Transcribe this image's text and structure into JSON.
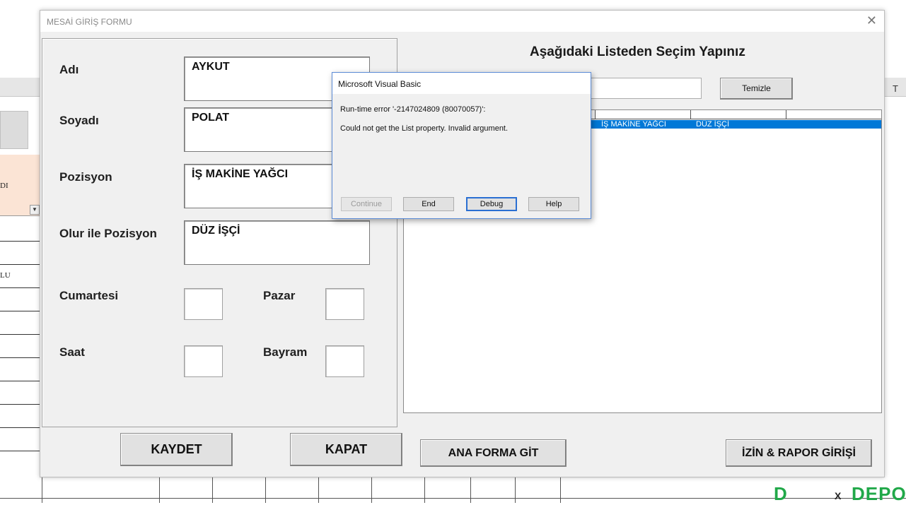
{
  "sheet": {
    "column_letter": "T",
    "cells": [
      "DI",
      "LU"
    ],
    "filter_icon": "dropdown-arrow-icon",
    "watermark": {
      "letter": "D",
      "mark": "X",
      "text": "DEPO"
    }
  },
  "form": {
    "title": "MESAİ GİRİŞ FORMU",
    "close_icon": "close-icon",
    "fields": {
      "adi": {
        "label": "Adı",
        "value": "AYKUT"
      },
      "soyadi": {
        "label": "Soyadı",
        "value": "POLAT"
      },
      "pozisyon": {
        "label": "Pozisyon",
        "value": "İŞ MAKİNE YAĞCI"
      },
      "olur_pozisyon": {
        "label": "Olur ile Pozisyon",
        "value": "DÜZ İŞÇİ"
      },
      "cumartesi": {
        "label": "Cumartesi",
        "value": ""
      },
      "pazar": {
        "label": "Pazar",
        "value": ""
      },
      "saat": {
        "label": "Saat",
        "value": ""
      },
      "bayram": {
        "label": "Bayram",
        "value": ""
      }
    },
    "buttons": {
      "kaydet": "KAYDET",
      "kapat": "KAPAT",
      "ana_forma_git": "ANA FORMA GİT",
      "izin_rapor": "İZİN & RAPOR GİRİŞİ",
      "temizle": "Temizle"
    },
    "right": {
      "heading": "Aşağıdaki Listeden Seçim Yapınız",
      "search_value": "",
      "list_rows": [
        {
          "pozisyon": "İŞ MAKİNE YAĞCI",
          "olur": "DÜZ İŞÇİ"
        }
      ]
    }
  },
  "dialog": {
    "title": "Microsoft Visual Basic",
    "line1": "Run-time error '-2147024809 (80070057)':",
    "line2": "Could not get the List property. Invalid argument.",
    "buttons": {
      "continue": "Continue",
      "end": "End",
      "debug": "Debug",
      "help": "Help"
    }
  }
}
